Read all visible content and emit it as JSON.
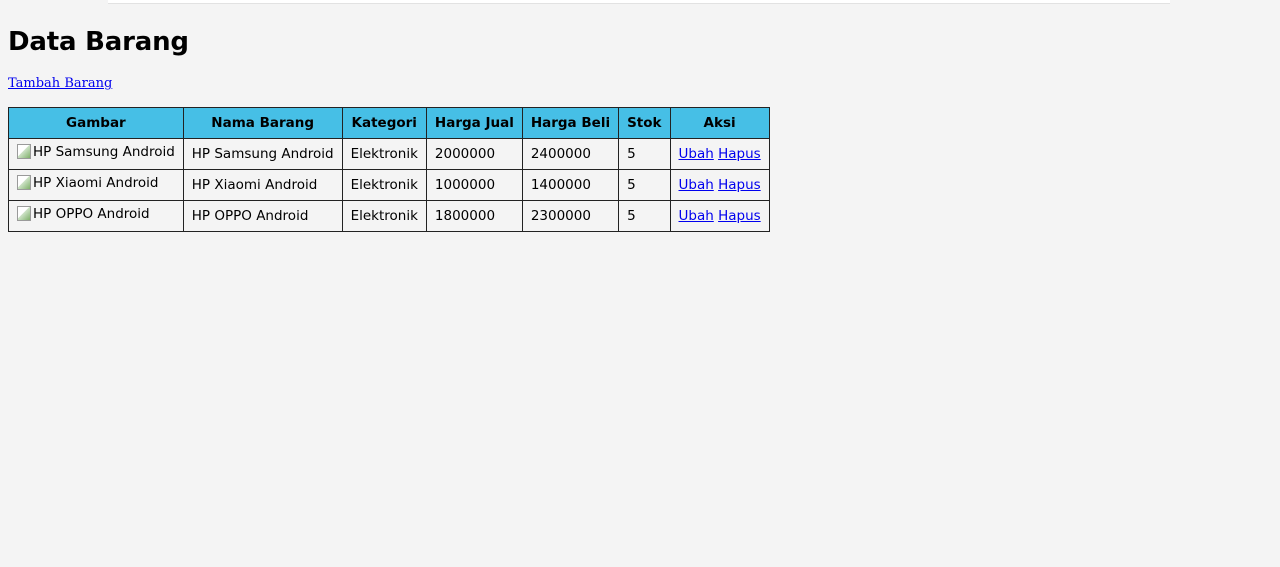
{
  "page": {
    "title": "Data Barang",
    "add_link": "Tambah Barang"
  },
  "table": {
    "headers": [
      "Gambar",
      "Nama Barang",
      "Kategori",
      "Harga Jual",
      "Harga Beli",
      "Stok",
      "Aksi"
    ],
    "rows": [
      {
        "gambar_alt": "HP Samsung Android",
        "nama": "HP Samsung Android",
        "kategori": "Elektronik",
        "harga_jual": "2000000",
        "harga_beli": "2400000",
        "stok": "5",
        "ubah": "Ubah",
        "hapus": "Hapus"
      },
      {
        "gambar_alt": "HP Xiaomi Android",
        "nama": "HP Xiaomi Android",
        "kategori": "Elektronik",
        "harga_jual": "1000000",
        "harga_beli": "1400000",
        "stok": "5",
        "ubah": "Ubah",
        "hapus": "Hapus"
      },
      {
        "gambar_alt": "HP OPPO Android",
        "nama": "HP OPPO Android",
        "kategori": "Elektronik",
        "harga_jual": "1800000",
        "harga_beli": "2300000",
        "stok": "5",
        "ubah": "Ubah",
        "hapus": "Hapus"
      }
    ]
  },
  "colors": {
    "background": "#f4f4f4",
    "header_bg": "#46bfe6",
    "link": "#0000ee"
  }
}
